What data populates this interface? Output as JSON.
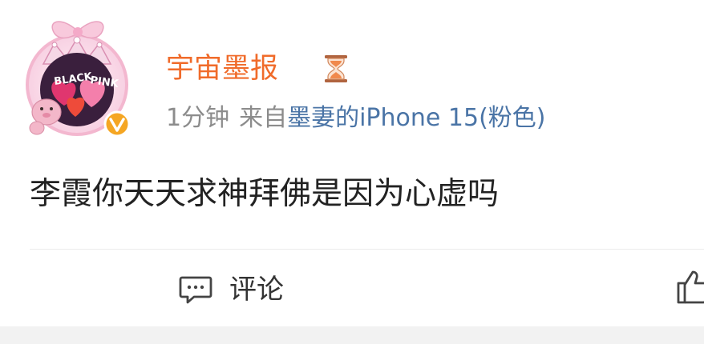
{
  "post": {
    "author": {
      "name": "宇宙墨报",
      "badge_icon": "hourglass-icon",
      "verified_icon": "verified-v-icon",
      "avatar_text": {
        "line1": "BLACK",
        "line2": "PINK"
      }
    },
    "meta": {
      "time": "1分钟",
      "from_prefix": "来自",
      "device": "墨妻的iPhone 15(粉色)"
    },
    "text": "李霞你天天求神拜佛是因为心虚吗"
  },
  "actions": {
    "comment_label": "评论",
    "comment_icon": "comment-icon",
    "like_icon": "thumbs-up-icon"
  },
  "colors": {
    "username": "#f06b2a",
    "device_link": "#4a74a6",
    "meta_gray": "#8c8c8c",
    "verified_badge": "#f5a623",
    "bottom_strip": "#f2f2f2"
  }
}
